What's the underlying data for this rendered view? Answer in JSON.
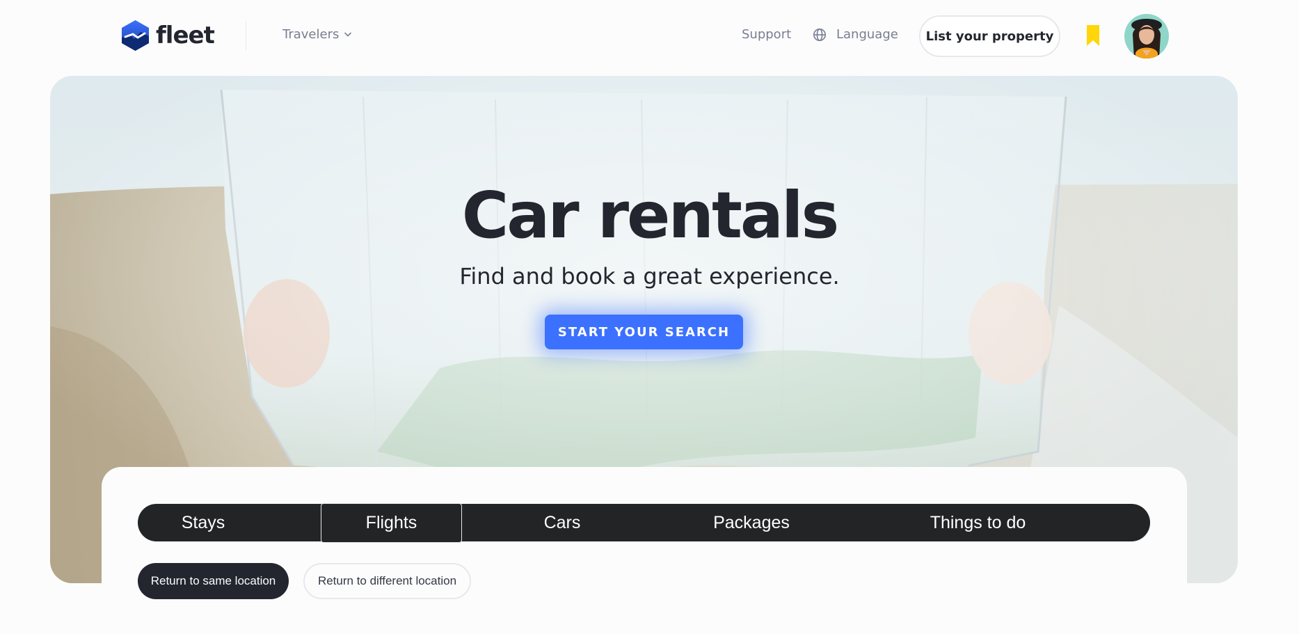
{
  "header": {
    "brand": "fleet",
    "travelers_label": "Travelers",
    "support_label": "Support",
    "language_label": "Language",
    "list_property_label": "List your property",
    "icons": [
      "logo-icon",
      "chevron-down-icon",
      "globe-icon",
      "bookmark-icon",
      "avatar"
    ]
  },
  "hero": {
    "title": "Car rentals",
    "subtitle": "Find and book a great experience.",
    "cta_label": "START YOUR SEARCH"
  },
  "search": {
    "tabs": [
      {
        "label": "Stays",
        "active": false
      },
      {
        "label": "Flights",
        "active": true
      },
      {
        "label": "Cars",
        "active": false
      },
      {
        "label": "Packages",
        "active": false
      },
      {
        "label": "Things to do",
        "active": false
      }
    ],
    "options": [
      {
        "label": "Return to same location",
        "selected": true
      },
      {
        "label": "Return to different location",
        "selected": false
      }
    ]
  },
  "colors": {
    "accent": "#3b71fe",
    "dark": "#23262f",
    "bookmark": "#ffd60a",
    "muted_text": "#777e90"
  }
}
